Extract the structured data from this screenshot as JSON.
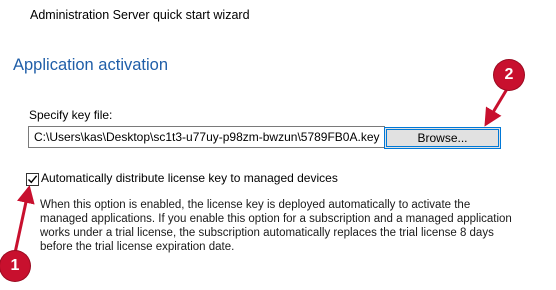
{
  "window": {
    "title": "Administration Server quick start wizard"
  },
  "page": {
    "heading": "Application activation"
  },
  "key_file": {
    "label": "Specify key file:",
    "path_value": "C:\\Users\\kas\\Desktop\\sc1t3-u77uy-p98zm-bwzun\\5789FB0A.key",
    "browse_label": "Browse..."
  },
  "auto_distribute": {
    "checked": true,
    "label": "Automatically distribute license key to managed devices",
    "help": "When this option is enabled, the license key is deployed automatically to activate the managed applications. If you enable this option for a subscription and a managed application works under a trial license, the subscription automatically replaces the trial license 8 days before the trial license expiration date."
  },
  "callouts": {
    "one": "1",
    "two": "2"
  },
  "colors": {
    "heading": "#1f5ea8",
    "callout": "#c8102e",
    "focus": "#0078d7"
  }
}
